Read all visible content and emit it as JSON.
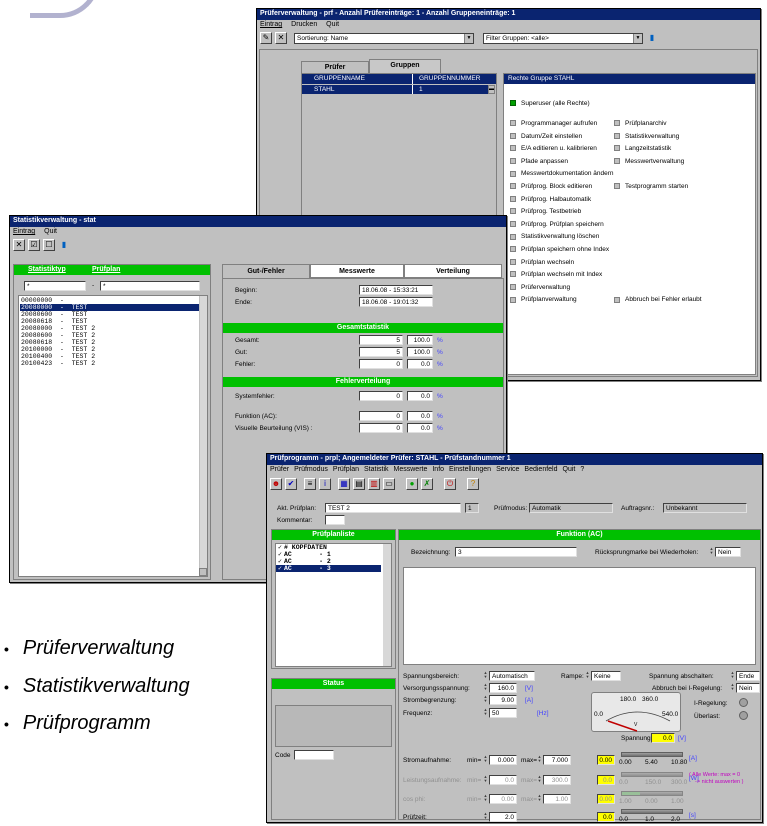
{
  "win1": {
    "title": "Prüferverwaltung - prf - Anzahl Prüfereinträge: 1 - Anzahl Gruppeneinträge: 1",
    "menu": [
      "Eintrag",
      "Drucken",
      "Quit"
    ],
    "sort_value": "Sortierung: Name",
    "filter_value": "Filter Gruppen: <alle>",
    "tabs": [
      "Prüfer",
      "Gruppen"
    ],
    "columns": [
      "GRUPPENNAME",
      "GRUPPENNUMMER"
    ],
    "rows": [
      {
        "name": "STAHL",
        "num": "1"
      }
    ],
    "rights_title": "Rechte Gruppe STAHL",
    "superuser": "Superuser (alle Rechte)",
    "rights_left": [
      "Programmanager aufrufen",
      "Datum/Zeit einstellen",
      "E/A editieren u. kalibrieren",
      "Pfade anpassen",
      "Messwertdokumentation ändern",
      "Prüfprog. Block editieren",
      "Prüfprog. Halbautomatik",
      "Prüfprog. Testbetrieb",
      "Prüfprog. Prüfplan speichern",
      "Statistikverwaltung löschen",
      "Prüfplan speichern ohne Index",
      "Prüfplan wechseln",
      "Prüfplan wechseln mit Index",
      "Prüferverwaltung",
      "Prüfplanverwaltung"
    ],
    "rights_right": [
      "Prüfplanarchiv",
      "Statistikverwaltung",
      "Langzeitstatistik",
      "Messwertverwaltung",
      "",
      "Testprogramm starten",
      "",
      "",
      "",
      "",
      "",
      "",
      "",
      "",
      "Abbruch bei Fehler erlaubt"
    ]
  },
  "win2": {
    "title": "Statistikverwaltung - stat",
    "menu": [
      "Eintrag",
      "Quit"
    ],
    "col_headers": [
      "Statistiktyp",
      "Prüfplan"
    ],
    "filter1": "*",
    "filter_sep": "-",
    "filter2": "*",
    "list": [
      "00000000  -",
      "20080000  -  TEST",
      "20080600  -  TEST",
      "20080618  -  TEST",
      "20080000  -  TEST 2",
      "20080600  -  TEST 2",
      "20080618  -  TEST 2",
      "20100000  -  TEST 2",
      "20100400  -  TEST 2",
      "20100423  -  TEST 2"
    ],
    "tabs": [
      "Gut-/Fehler",
      "Messwerte",
      "Verteilung"
    ],
    "beginn_label": "Beginn:",
    "beginn": "18.06.08 - 15:33:21",
    "ende_label": "Ende:",
    "ende": "18.06.08 - 19:01:32",
    "gesamt_title": "Gesamtstatistik",
    "gesamt_rows": [
      {
        "label": "Gesamt:",
        "n": "5",
        "p": "100.0"
      },
      {
        "label": "Gut:",
        "n": "5",
        "p": "100.0"
      },
      {
        "label": "Fehler:",
        "n": "0",
        "p": "0.0"
      }
    ],
    "fehler_title": "Fehlerverteilung",
    "fehler_rows": [
      {
        "label": "Systemfehler:",
        "n": "0",
        "p": "0.0"
      },
      {
        "label": "Funktion (AC):",
        "n": "0",
        "p": "0.0"
      },
      {
        "label": "Visuelle Beurteilung (VIS) :",
        "n": "0",
        "p": "0.0"
      }
    ],
    "pct": "%"
  },
  "win3": {
    "title": "Prüfprogramm  -  prpl;  Angemeldeter Prüfer: STAHL  -  Prüfstandnummer 1",
    "menu": [
      "Prüfer",
      "Prüfmodus",
      "Prüfplan",
      "Statistik",
      "Messwerte",
      "Info",
      "Einstellungen",
      "Service",
      "Bedienfeld",
      "Quit",
      "?"
    ],
    "pruefplan_label": "Akt. Prüfplan:",
    "pruefplan": "TEST 2",
    "pruefplan_nr": "1",
    "modus_label": "Prüfmodus:",
    "modus": "Automatik",
    "auftrag_label": "Auftragsnr.:",
    "auftrag": "Unbekannt",
    "kommentar_label": "Kommentar:",
    "liste_title": "Prüfplanliste",
    "liste": [
      "# KOPFDATEN",
      "AC       - 1",
      "AC       - 2",
      "AC       - 3"
    ],
    "status_title": "Status",
    "code_label": "Code",
    "funktion_title": "Funktion (AC)",
    "bezeichnung_label": "Bezeichnung:",
    "bezeichnung": "3",
    "ruecksprung_label": "Rücksprungmarke bei Wiederholen:",
    "ruecksprung": "Nein",
    "spannungsbereich_label": "Spannungsbereich:",
    "spannungsbereich": "Automatisch",
    "rampe_label": "Rampe:",
    "rampe": "Keine",
    "abschalten_label": "Spannung abschalten:",
    "abschalten": "Ende",
    "versorgung_label": "Versorgungsspannung:",
    "versorgung": "160.0",
    "versorgung_unit": "[V]",
    "abbruch_label": "Abbruch bei I-Regelung:",
    "abbruch": "Nein",
    "strombegrenzung_label": "Strombegrenzung:",
    "strombegrenzung": "9.00",
    "strom_unit": "[A]",
    "frequenz_label": "Frequenz:",
    "frequenz": "50",
    "frequenz_unit": "[Hz]",
    "meter_labels": [
      "180.0",
      "360.0",
      "0.0",
      "540.0"
    ],
    "meter_v": "V",
    "iregelung_label": "I-Regelung:",
    "ueberlast_label": "Überlast:",
    "spannung_label": "Spannung:",
    "spannung": "0.0",
    "spannung_unit": "[V]",
    "stromaufnahme_label": "Stromaufnahme:",
    "min_label": "min=",
    "max_label": "max=",
    "stromaufnahme_min": "0.000",
    "stromaufnahme_max": "7.000",
    "stromaufnahme_val": "0.00",
    "scale1": [
      "0.00",
      "5.40",
      "10.80"
    ],
    "unit_a": "[A]",
    "leistung_label": "Leistungsaufnahme:",
    "leistung_min": "0.0",
    "leistung_max": "300.0",
    "leistung_val": "0.0",
    "scale2": [
      "0.0",
      "150.0",
      "300.0"
    ],
    "unit_w": "[W]",
    "cosphi_label": "cos phi:",
    "cosphi_min": "0.00",
    "cosphi_max": "1.00",
    "cosphi_val": "0.00",
    "scale3": [
      "1.00",
      "0.00",
      "1.00"
    ],
    "note": "( Alle Werte: max = 0",
    "note2": "-> nicht auswerten )",
    "pruefzeit_label": "Prüfzeit:",
    "pruefzeit": "2.0",
    "pruefzeit_val": "0.0",
    "scale4": [
      "0.0",
      "1.0",
      "2.0"
    ],
    "unit_s": "[s]"
  },
  "bullets": [
    "Prüferverwaltung",
    "Statistikverwaltung",
    "Prüfprogramm"
  ]
}
